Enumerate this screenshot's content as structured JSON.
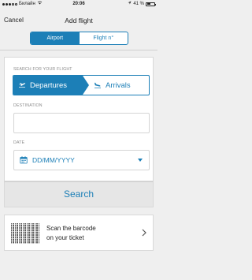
{
  "status_bar": {
    "carrier": "Билайн",
    "time": "20:06",
    "battery_percent": "41 %",
    "battery_level": 0.41
  },
  "nav": {
    "cancel_label": "Cancel",
    "title": "Add flight"
  },
  "segment": {
    "options": [
      "Airport",
      "Flight n°"
    ],
    "selected_index": 0
  },
  "form": {
    "search_label": "SEARCH FOR YOUR FLIGHT",
    "directions": [
      "Departures",
      "Arrivals"
    ],
    "selected_direction": 0,
    "destination_label": "DESTINATION",
    "destination_value": "",
    "date_label": "DATE",
    "date_placeholder": "DD/MM/YYYY"
  },
  "search_button_label": "Search",
  "scan": {
    "line1": "Scan the barcode",
    "line2": "on your ticket"
  },
  "colors": {
    "accent": "#1c7fb7",
    "background": "#efefef"
  }
}
